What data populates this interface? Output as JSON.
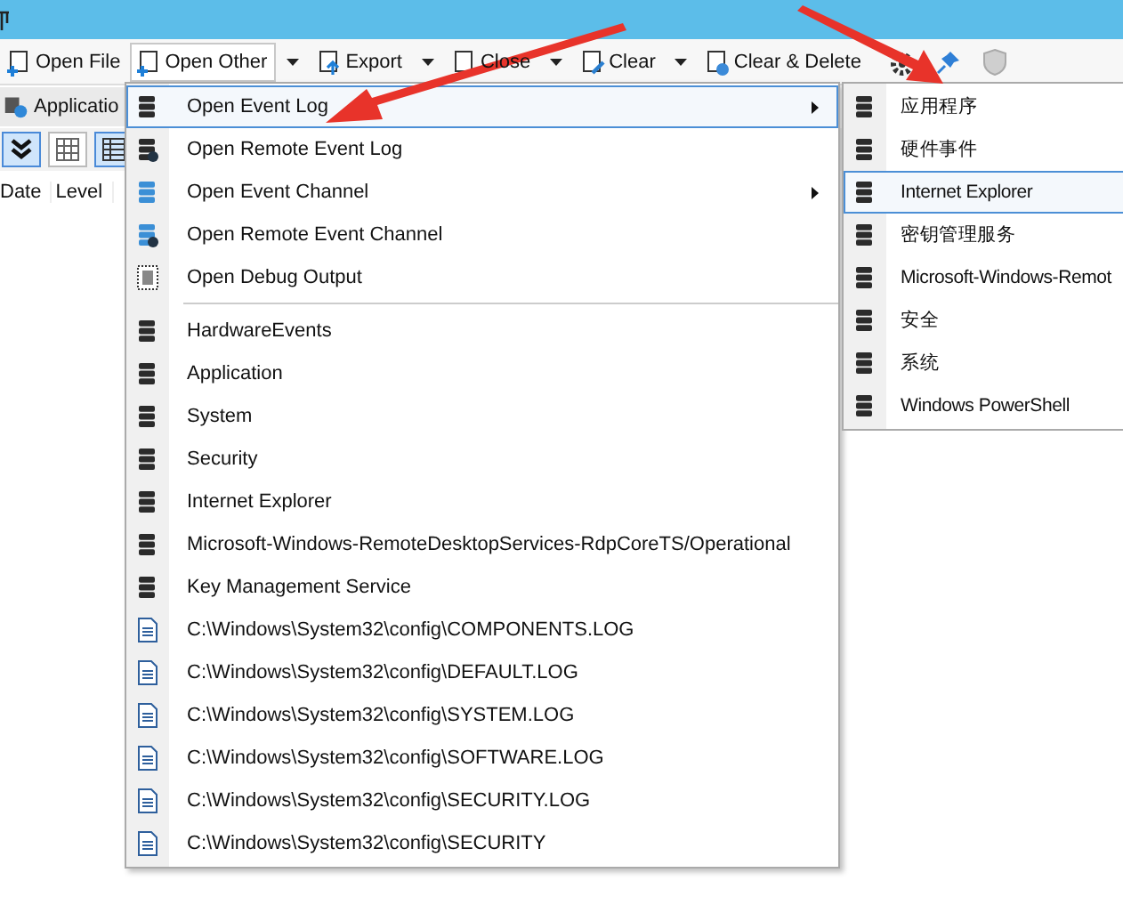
{
  "toolbar": [
    {
      "label": "Open File",
      "kind": "open",
      "dropdown": false,
      "selected": false
    },
    {
      "label": "Open Other",
      "kind": "open",
      "dropdown": true,
      "selected": true
    },
    {
      "label": "Export",
      "kind": "export",
      "dropdown": true,
      "selected": false
    },
    {
      "label": "Close",
      "kind": "page",
      "dropdown": true,
      "selected": false
    },
    {
      "label": "Clear",
      "kind": "clear",
      "dropdown": true,
      "selected": false
    },
    {
      "label": "Clear & Delete",
      "kind": "delete",
      "dropdown": false,
      "selected": false
    }
  ],
  "log_tab": {
    "label": "Applicatio"
  },
  "view_buttons": [
    {
      "kind": "expand",
      "selected": true
    },
    {
      "kind": "grid",
      "selected": false
    },
    {
      "kind": "table",
      "selected": true
    }
  ],
  "table": {
    "columns": [
      "Date",
      "Level"
    ]
  },
  "menu": {
    "items": [
      {
        "kind": "log",
        "label": "Open Event Log",
        "submenu": true,
        "selected": true
      },
      {
        "kind": "remote",
        "label": "Open Remote Event Log",
        "submenu": false,
        "selected": false
      },
      {
        "kind": "channel",
        "label": "Open Event Channel",
        "submenu": true,
        "selected": false
      },
      {
        "kind": "remote_channel",
        "label": "Open Remote Event Channel",
        "submenu": false,
        "selected": false
      },
      {
        "kind": "debug",
        "label": "Open Debug Output",
        "submenu": false,
        "selected": false
      },
      {
        "kind": "separator"
      },
      {
        "kind": "log",
        "label": "HardwareEvents",
        "submenu": false,
        "selected": false
      },
      {
        "kind": "log",
        "label": "Application",
        "submenu": false,
        "selected": false
      },
      {
        "kind": "log",
        "label": "System",
        "submenu": false,
        "selected": false
      },
      {
        "kind": "log",
        "label": "Security",
        "submenu": false,
        "selected": false
      },
      {
        "kind": "log",
        "label": "Internet Explorer",
        "submenu": false,
        "selected": false
      },
      {
        "kind": "log",
        "label": "Microsoft-Windows-RemoteDesktopServices-RdpCoreTS/Operational",
        "submenu": false,
        "selected": false
      },
      {
        "kind": "log",
        "label": "Key Management Service",
        "submenu": false,
        "selected": false
      },
      {
        "kind": "file",
        "label": "C:\\Windows\\System32\\config\\COMPONENTS.LOG",
        "submenu": false,
        "selected": false
      },
      {
        "kind": "file",
        "label": "C:\\Windows\\System32\\config\\DEFAULT.LOG",
        "submenu": false,
        "selected": false
      },
      {
        "kind": "file",
        "label": "C:\\Windows\\System32\\config\\SYSTEM.LOG",
        "submenu": false,
        "selected": false
      },
      {
        "kind": "file",
        "label": "C:\\Windows\\System32\\config\\SOFTWARE.LOG",
        "submenu": false,
        "selected": false
      },
      {
        "kind": "file",
        "label": "C:\\Windows\\System32\\config\\SECURITY.LOG",
        "submenu": false,
        "selected": false
      },
      {
        "kind": "file",
        "label": "C:\\Windows\\System32\\config\\SECURITY",
        "submenu": false,
        "selected": false
      }
    ]
  },
  "submenu": {
    "items": [
      {
        "label": "应用程序",
        "selected": false
      },
      {
        "label": "硬件事件",
        "selected": false
      },
      {
        "label": "Internet Explorer",
        "selected": true
      },
      {
        "label": "密钥管理服务",
        "selected": false
      },
      {
        "label": "Microsoft-Windows-Remot",
        "selected": false
      },
      {
        "label": "安全",
        "selected": false
      },
      {
        "label": "系统",
        "selected": false
      },
      {
        "label": "Windows PowerShell",
        "selected": false
      }
    ]
  }
}
